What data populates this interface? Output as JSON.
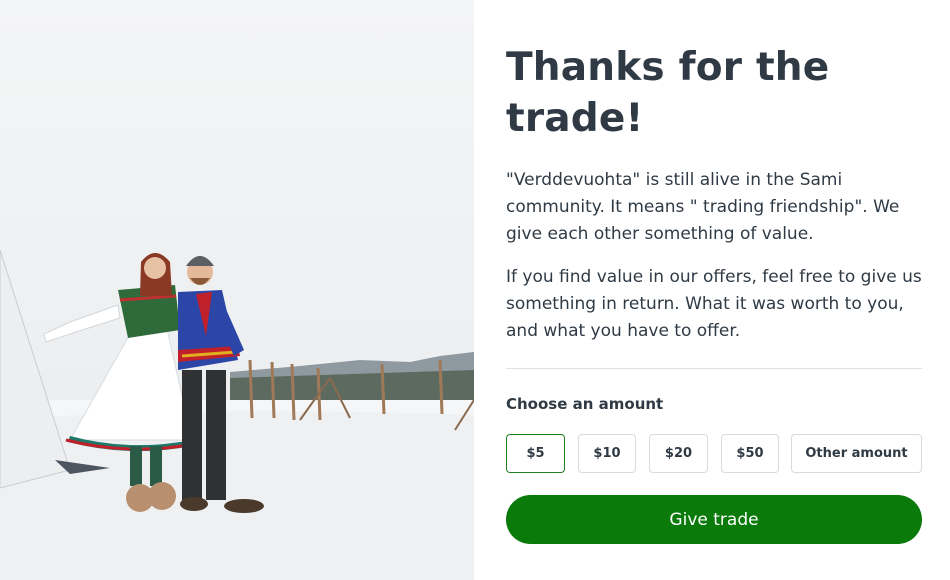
{
  "photo": {
    "alt_subject": "couple-in-sami-clothing"
  },
  "thanks": {
    "title": "Thanks for the trade!",
    "paragraph_1": "\"Verddevuohta\" is still alive in the Sami community. It means \" trading friendship\". We give each other something of value.",
    "paragraph_2": "If you find value in our offers, feel free to give us something in return. What it was worth to you, and what you have to offer."
  },
  "amount": {
    "label": "Choose an amount",
    "options": [
      "$5",
      "$10",
      "$20",
      "$50",
      "Other amount"
    ],
    "selected": "$5"
  },
  "submit": {
    "label": "Give trade"
  },
  "colors": {
    "primary_green": "#0a7a0a",
    "text": "#2f3a45",
    "selected_border": "#1f7f1f"
  }
}
